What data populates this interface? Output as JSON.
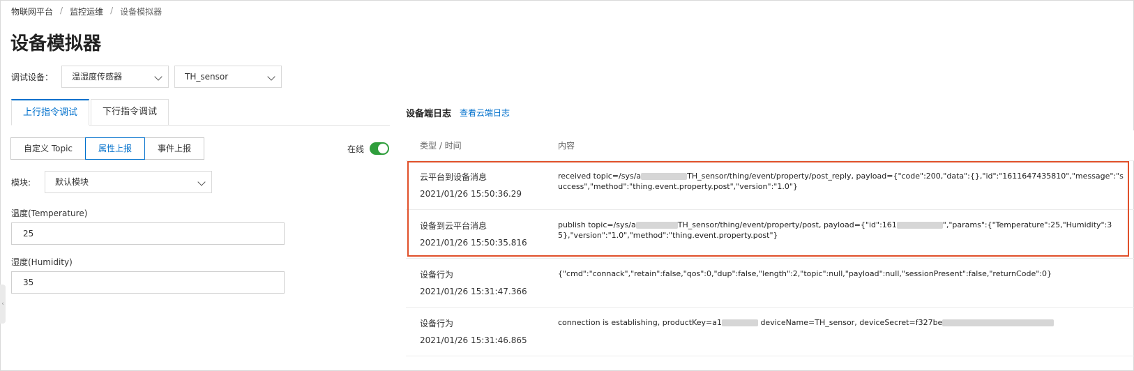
{
  "breadcrumb": {
    "items": [
      "物联网平台",
      "监控运维",
      "设备模拟器"
    ],
    "separator": "/"
  },
  "page": {
    "title": "设备模拟器"
  },
  "device": {
    "label": "调试设备：",
    "product_value": "温湿度传感器",
    "device_value": "TH_sensor"
  },
  "tabs": {
    "uplink": "上行指令调试",
    "downlink": "下行指令调试"
  },
  "segments": {
    "custom_topic": "自定义 Topic",
    "property_report": "属性上报",
    "event_report": "事件上报"
  },
  "online": {
    "label": "在线",
    "enabled": true
  },
  "module": {
    "label": "模块:",
    "value": "默认模块"
  },
  "fields": {
    "temperature_label": "温度(Temperature)",
    "temperature_value": "25",
    "humidity_label": "湿度(Humidity)",
    "humidity_value": "35"
  },
  "log": {
    "title": "设备端日志",
    "cloud_link": "查看云端日志",
    "col_type_time": "类型 / 时间",
    "col_content": "内容",
    "rows": [
      {
        "type": "云平台到设备消息",
        "time": "2021/01/26 15:50:36.29",
        "content_a": "received topic=/sys/a",
        "content_b": "TH_sensor/thing/event/property/post_reply, payload={\"code\":200,\"data\":{},\"id\":\"1611647435810\",\"message\":\"success\",\"method\":\"thing.event.property.post\",\"version\":\"1.0\"}"
      },
      {
        "type": "设备到云平台消息",
        "time": "2021/01/26 15:50:35.816",
        "content_a": "publish topic=/sys/a",
        "content_b": "TH_sensor/thing/event/property/post, payload={\"id\":161",
        "content_c": "\",\"params\":{\"Temperature\":25,\"Humidity\":35},\"version\":\"1.0\",\"method\":\"thing.event.property.post\"}"
      },
      {
        "type": "设备行为",
        "time": "2021/01/26 15:31:47.366",
        "content_a": "{\"cmd\":\"connack\",\"retain\":false,\"qos\":0,\"dup\":false,\"length\":2,\"topic\":null,\"payload\":null,\"sessionPresent\":false,\"returnCode\":0}"
      },
      {
        "type": "设备行为",
        "time": "2021/01/26 15:31:46.865",
        "content_a": "connection is establishing, productKey=a1",
        "content_b": " deviceName=TH_sensor, deviceSecret=f327be"
      }
    ]
  },
  "colors": {
    "accent": "#0070cc",
    "highlight": "#e0502a",
    "toggle_on": "#2f9e3c"
  }
}
